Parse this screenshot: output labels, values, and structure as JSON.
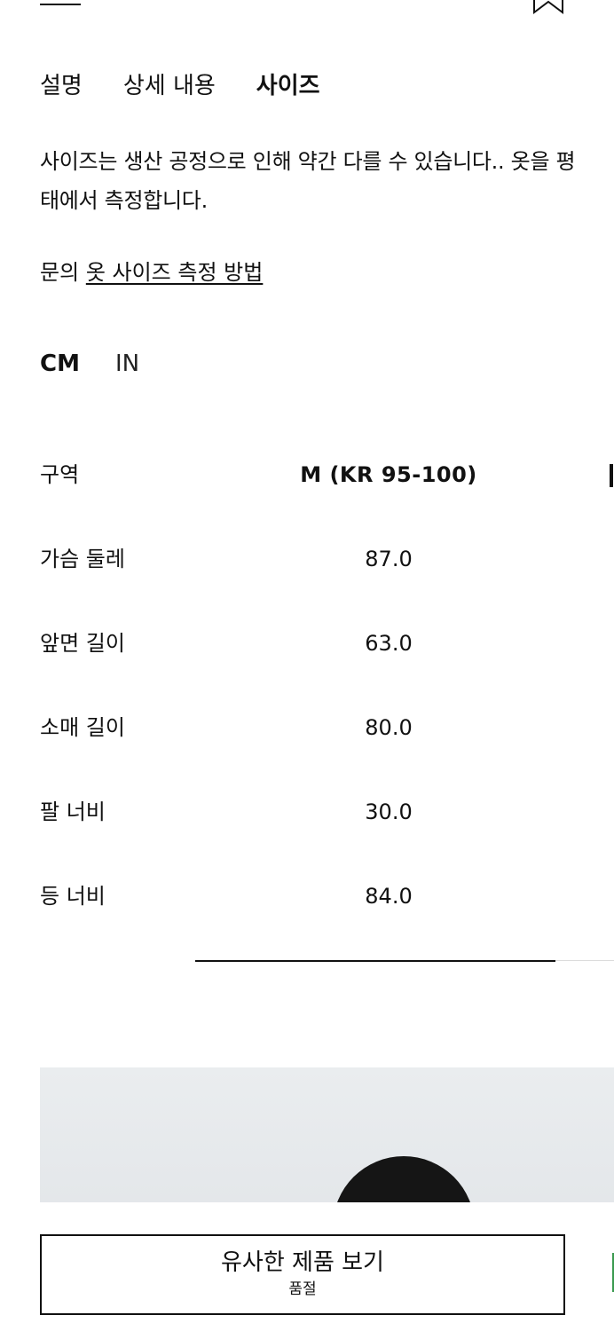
{
  "tabs": [
    {
      "label": "설명",
      "active": false
    },
    {
      "label": "상세 내용",
      "active": false
    },
    {
      "label": "사이즈",
      "active": true
    }
  ],
  "note": {
    "line1": "사이즈는 생산 공정으로 인해 약간 다를 수 있습니다.. 옷을 평",
    "line2": "태에서 측정합니다."
  },
  "links": {
    "prefix": "문의",
    "how_to_measure": "옷 사이즈 측정 방법"
  },
  "units": {
    "cm": "CM",
    "in": "IN",
    "selected": "CM"
  },
  "size_table": {
    "header_label": "구역",
    "column": "M (KR 95-100)",
    "rows": [
      {
        "label": "가슴 둘레",
        "value": "87.0"
      },
      {
        "label": "앞면 길이",
        "value": "63.0"
      },
      {
        "label": "소매 길이",
        "value": "80.0"
      },
      {
        "label": "팔 너비",
        "value": "30.0"
      },
      {
        "label": "등 너비",
        "value": "84.0"
      }
    ]
  },
  "similar_button": {
    "label": "유사한 제품 보기",
    "status": "품절"
  },
  "icons": {
    "bookmark": "bookmark-icon",
    "menu": "menu-line-icon"
  }
}
